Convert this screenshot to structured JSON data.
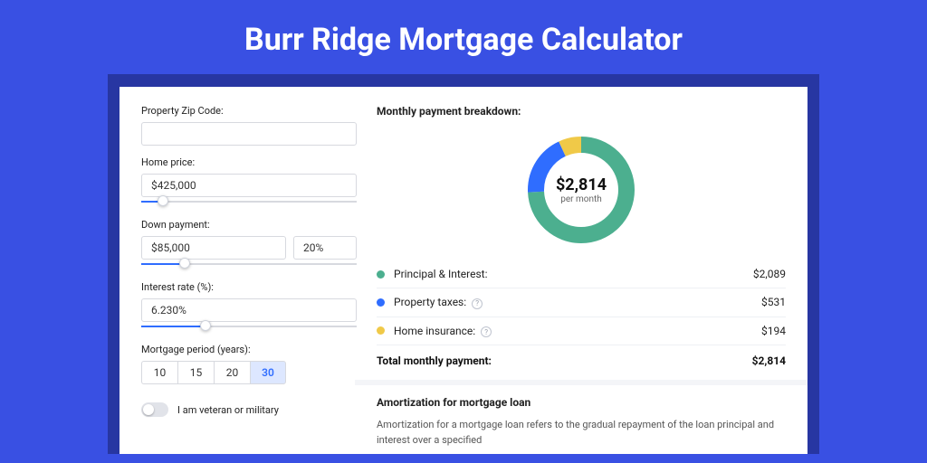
{
  "page_title": "Burr Ridge Mortgage Calculator",
  "form": {
    "zip": {
      "label": "Property Zip Code:",
      "value": ""
    },
    "home_price": {
      "label": "Home price:",
      "value": "$425,000",
      "slider_pct": 10
    },
    "down_payment": {
      "label": "Down payment:",
      "value": "$85,000",
      "pct": "20%",
      "slider_pct": 20
    },
    "interest": {
      "label": "Interest rate (%):",
      "value": "6.230%",
      "slider_pct": 30
    },
    "period": {
      "label": "Mortgage period (years):",
      "options": [
        "10",
        "15",
        "20",
        "30"
      ],
      "selected": "30"
    },
    "veteran": {
      "label": "I am veteran or military",
      "on": false
    }
  },
  "breakdown": {
    "title": "Monthly payment breakdown:",
    "center_amount": "$2,814",
    "center_sub": "per month",
    "items": [
      {
        "name": "Principal & Interest:",
        "value": "$2,089",
        "color": "#4caf8f",
        "has_info": false
      },
      {
        "name": "Property taxes:",
        "value": "$531",
        "color": "#2f6dff",
        "has_info": true
      },
      {
        "name": "Home insurance:",
        "value": "$194",
        "color": "#f0c948",
        "has_info": true
      }
    ],
    "total": {
      "name": "Total monthly payment:",
      "value": "$2,814"
    }
  },
  "amortization": {
    "title": "Amortization for mortgage loan",
    "text": "Amortization for a mortgage loan refers to the gradual repayment of the loan principal and interest over a specified"
  },
  "chart_data": {
    "type": "pie",
    "title": "Monthly payment breakdown",
    "series": [
      {
        "name": "Principal & Interest",
        "value": 2089,
        "color": "#4caf8f"
      },
      {
        "name": "Property taxes",
        "value": 531,
        "color": "#2f6dff"
      },
      {
        "name": "Home insurance",
        "value": 194,
        "color": "#f0c948"
      }
    ],
    "total": 2814,
    "center_label": "$2,814 per month"
  }
}
